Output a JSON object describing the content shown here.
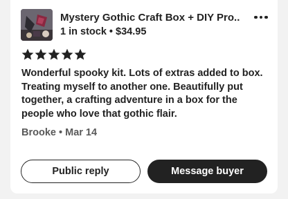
{
  "product": {
    "thumbnail_icon": "product-thumbnail",
    "title": "Mystery Gothic Craft Box + DIY Pro...",
    "stock": "1 in stock",
    "separator": " • ",
    "price": "$34.95",
    "more_icon": "more-horizontal-icon"
  },
  "review": {
    "rating": 5,
    "rating_max": 5,
    "star_color": "#222222",
    "text": "Wonderful spooky kit. Lots of extras added to box. Treating myself to another one. Beautifully put together, a crafting adventure in a box for the people who love that gothic flair.",
    "reviewer": "Brooke",
    "date_separator": " • ",
    "date": "Mar 14"
  },
  "actions": {
    "public_reply_label": "Public reply",
    "message_buyer_label": "Message buyer"
  },
  "colors": {
    "background": "#f2f2f2",
    "card": "#ffffff",
    "primary_button": "#222222",
    "muted_text": "#595959"
  }
}
